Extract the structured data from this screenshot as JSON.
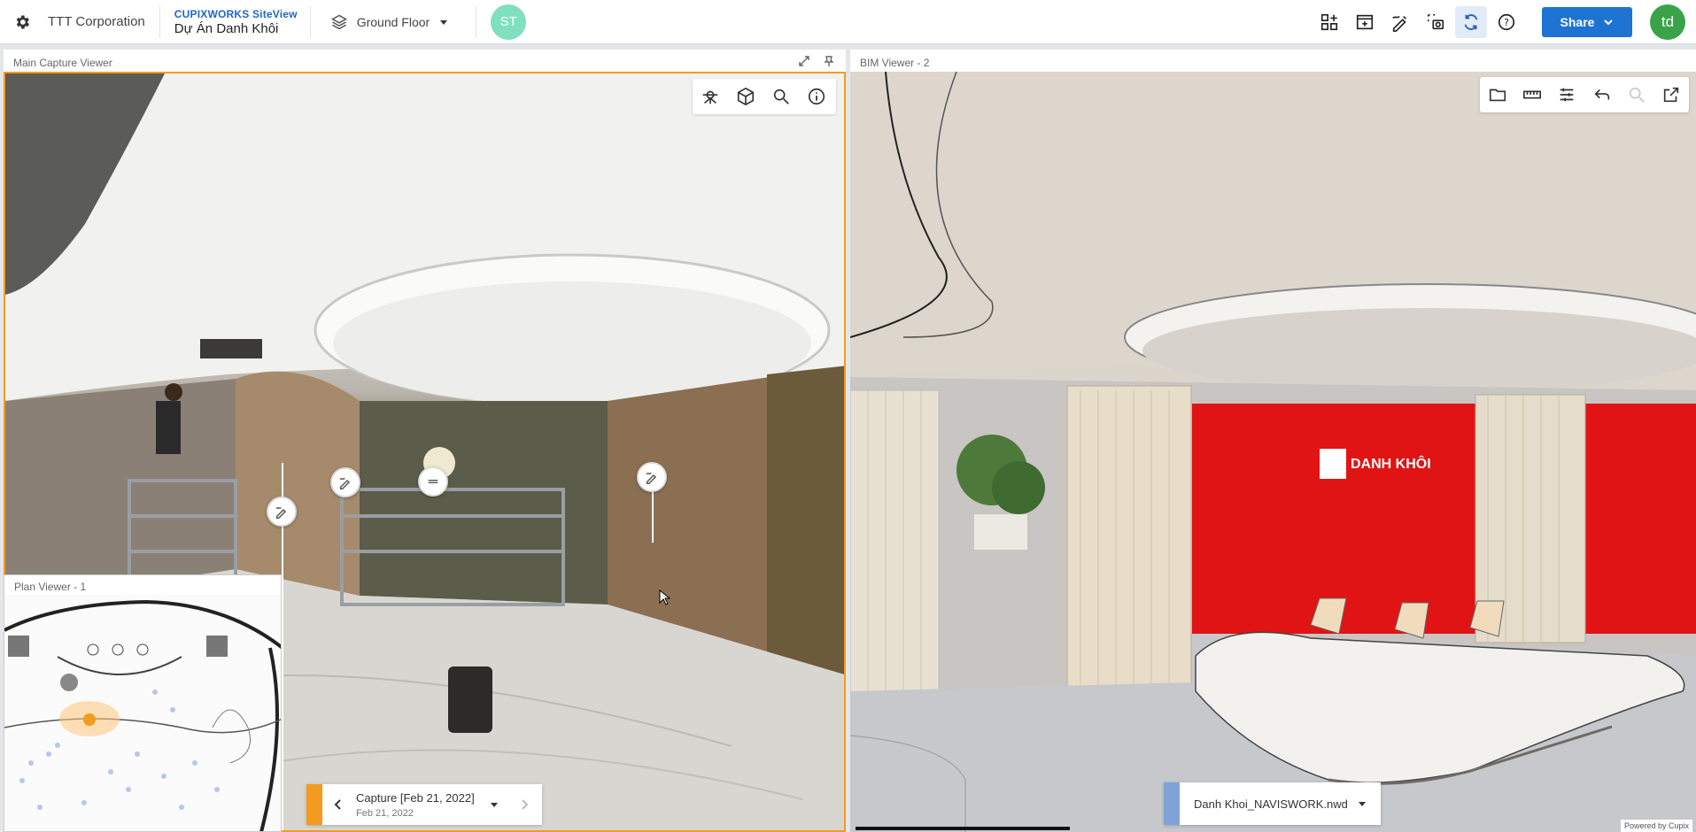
{
  "header": {
    "org_name": "TTT Corporation",
    "brand_logo": "CUPIXWORKS SiteView",
    "project_name": "Dự Án Danh Khôi",
    "floor": "Ground Floor",
    "collaborator_initials": "ST",
    "user_initials": "td",
    "share_label": "Share",
    "tools": [
      "layout-icon",
      "add-panel-icon",
      "markup-icon",
      "capture-snapshot-icon",
      "sync-icon",
      "help-icon"
    ]
  },
  "main_viewer": {
    "title": "Main Capture Viewer",
    "tools": [
      "tripod-icon",
      "model-cube-icon",
      "zoom-search-icon",
      "info-icon"
    ],
    "capture": {
      "title": "Capture [Feb 21, 2022]",
      "date": "Feb 21, 2022"
    }
  },
  "plan_viewer": {
    "title": "Plan Viewer - 1"
  },
  "bim_viewer": {
    "title": "BIM Viewer - 2",
    "tools": [
      "folder-icon",
      "measure-ruler-icon",
      "settings-sliders-icon",
      "undo-arrow-icon",
      "zoom-search-icon",
      "open-external-icon"
    ],
    "model_name": "Danh Khoi_NAVISWORK.nwd",
    "sign_text": "DANH KHÔI",
    "powered_by": "Powered by Cupix"
  },
  "colors": {
    "accent": "#1e73d2",
    "capture_border": "#f39b1e",
    "model_accent": "#7fa3d8",
    "brand_red": "#e01414"
  }
}
